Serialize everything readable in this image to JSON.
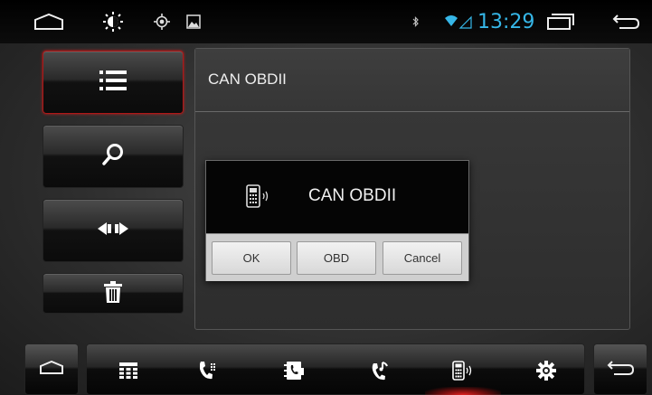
{
  "status_bar": {
    "time": "13:29",
    "icons": [
      "home-icon",
      "brightness-icon",
      "gps-icon",
      "picture-icon",
      "bluetooth-icon",
      "wifi-icon",
      "recent-apps-icon",
      "back-icon"
    ]
  },
  "sidebar": {
    "items": [
      {
        "icon": "list-icon",
        "active": true
      },
      {
        "icon": "search-icon",
        "active": false
      },
      {
        "icon": "connect-icon",
        "active": false
      },
      {
        "icon": "delete-icon",
        "active": false
      }
    ]
  },
  "panel": {
    "title": "CAN OBDII"
  },
  "dialog": {
    "message": "CAN OBDII",
    "icon": "obd-device-icon",
    "buttons": {
      "ok": "OK",
      "obd": "OBD",
      "cancel": "Cancel"
    }
  },
  "bottom_nav": {
    "items": [
      "home-icon",
      "apps-grid-icon",
      "phone-dialpad-icon",
      "contacts-icon",
      "music-call-icon",
      "obd-icon",
      "settings-icon",
      "back-icon"
    ],
    "active": "obd-icon",
    "accent_color": "#e02020"
  },
  "colors": {
    "clock": "#36b7e8",
    "active_border": "#b01818"
  }
}
